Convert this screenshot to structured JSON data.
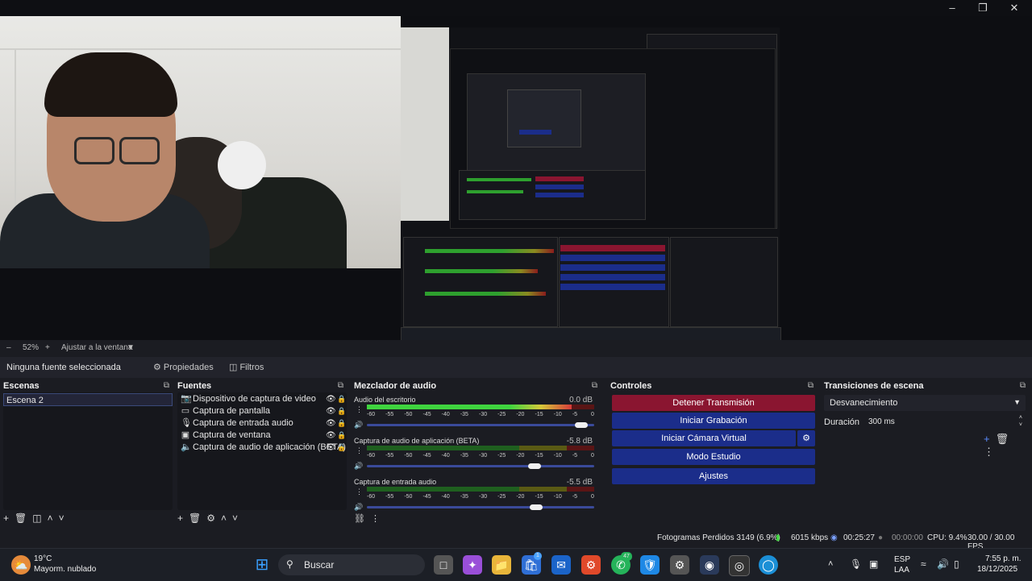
{
  "preview": {
    "zoom": "52%",
    "fit_label": "Ajustar a la ventana"
  },
  "sourcebar": {
    "status": "Ninguna fuente seleccionada",
    "properties": "Propiedades",
    "filters": "Filtros"
  },
  "scenes": {
    "title": "Escenas",
    "items": [
      "Escena 2"
    ]
  },
  "sources": {
    "title": "Fuentes",
    "items": [
      {
        "label": "Dispositivo de captura de video",
        "icon": "camera-icon"
      },
      {
        "label": "Captura de pantalla",
        "icon": "monitor-icon"
      },
      {
        "label": "Captura de entrada audio",
        "icon": "microphone-icon"
      },
      {
        "label": "Captura de ventana",
        "icon": "window-icon"
      },
      {
        "label": "Captura de audio de aplicación (BETA)",
        "icon": "speaker-icon"
      }
    ]
  },
  "mixer": {
    "title": "Mezclador de audio",
    "scale": [
      "-60",
      "-55",
      "-50",
      "-45",
      "-40",
      "-35",
      "-30",
      "-25",
      "-20",
      "-15",
      "-10",
      "-5",
      "0"
    ],
    "channels": [
      {
        "name": "Audio del escritorio",
        "db": "0.0 dB",
        "level": 0.9,
        "fader": 0.97
      },
      {
        "name": "Captura de audio de aplicación (BETA)",
        "db": "-5.8 dB",
        "level": 0.0,
        "fader": 0.75
      },
      {
        "name": "Captura de entrada audio",
        "db": "-5.5 dB",
        "level": 0.0,
        "fader": 0.76
      }
    ]
  },
  "controls": {
    "title": "Controles",
    "stop_stream": "Detener Transmisión",
    "start_recording": "Iniciar Grabación",
    "start_virtual_cam": "Iniciar Cámara Virtual",
    "studio_mode": "Modo Estudio",
    "settings": "Ajustes"
  },
  "transitions": {
    "title": "Transiciones de escena",
    "selected": "Desvanecimiento",
    "duration_label": "Duración",
    "duration_value": "300 ms"
  },
  "status": {
    "dropped": "Fotogramas Perdidos 3149 (6.9%)",
    "bitrate": "6015 kbps",
    "stream_time": "00:25:27",
    "record_time": "00:00:00",
    "cpu": "CPU: 9.4%",
    "fps": "30.00 / 30.00 FPS"
  },
  "taskbar": {
    "temp": "19°C",
    "weather": "Mayorm. nublado",
    "search": "Buscar",
    "lang1": "ESP",
    "lang2": "LAA",
    "time": "7:55 p. m.",
    "date": "18/12/2025",
    "store_badge": "1",
    "whatsapp_badge": "47"
  },
  "colors": {
    "stop_red": "#8a1530",
    "button_blue": "#1b2d8a",
    "meter_green": "#3fd43f"
  }
}
